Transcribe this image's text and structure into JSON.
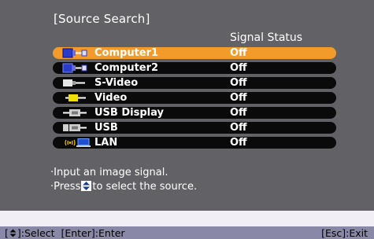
{
  "title": "[Source Search]",
  "header": "Signal Status",
  "sources": [
    {
      "label": "Computer1",
      "status": "Off",
      "icon": "computer-icon",
      "selected": true
    },
    {
      "label": "Computer2",
      "status": "Off",
      "icon": "computer-icon",
      "selected": false
    },
    {
      "label": "S-Video",
      "status": "Off",
      "icon": "s-video-icon",
      "selected": false
    },
    {
      "label": "Video",
      "status": "Off",
      "icon": "video-icon",
      "selected": false
    },
    {
      "label": "USB Display",
      "status": "Off",
      "icon": "usb-display-icon",
      "selected": false
    },
    {
      "label": "USB",
      "status": "Off",
      "icon": "usb-icon",
      "selected": false
    },
    {
      "label": "LAN",
      "status": "Off",
      "icon": "lan-icon",
      "selected": false
    }
  ],
  "message": {
    "line1": "·Input an image signal.",
    "line2_prefix": "·Press",
    "line2_suffix": "to select the source."
  },
  "footer": {
    "select_open": "[",
    "select_close": "]:Select  [Enter]:Enter",
    "exit": "[Esc]:Exit"
  },
  "colors": {
    "panel": "#626266",
    "selected_row": "#f29b2a",
    "row": "#0a0a0a",
    "footer": "#8a88a7"
  }
}
